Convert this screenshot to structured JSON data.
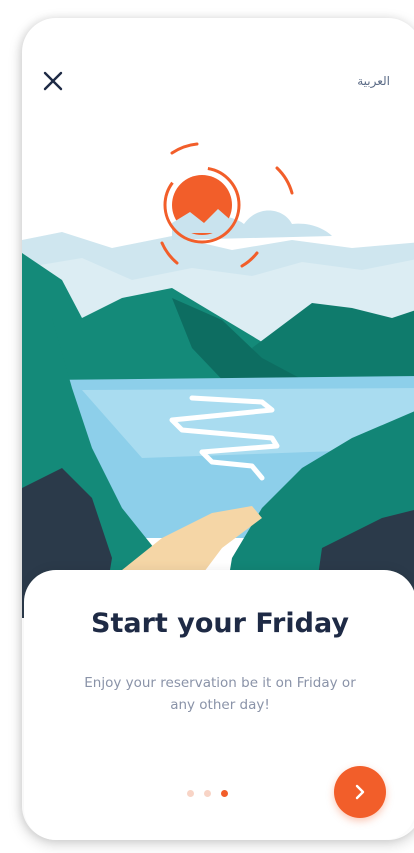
{
  "header": {
    "close_icon": "close-icon",
    "language_link": "العربية"
  },
  "onboarding": {
    "title": "Start your Friday",
    "subtitle": "Enjoy your reservation be it on Friday or any other day!",
    "pagination": {
      "total": 3,
      "active_index": 2
    },
    "next_icon": "chevron-right-icon"
  },
  "colors": {
    "accent": "#F25E2A",
    "title": "#1E2A45",
    "subtitle": "#8A93A8",
    "mountain_green": "#128576",
    "water": "#8DCFEA",
    "sky": "#CFE6EF"
  }
}
